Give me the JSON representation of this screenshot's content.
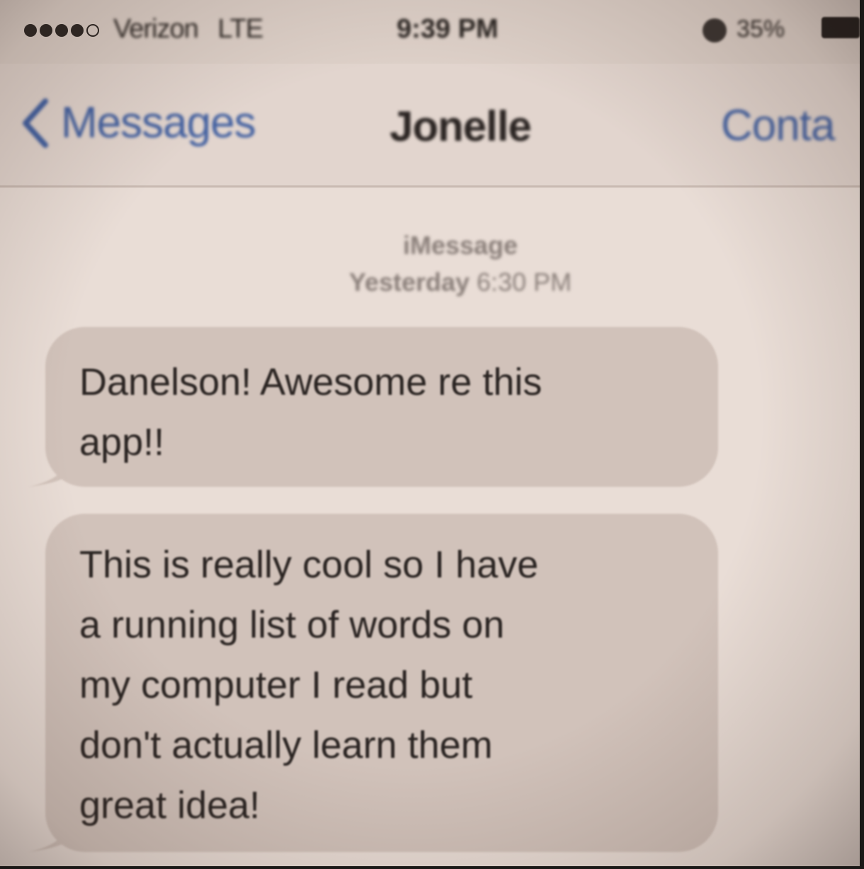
{
  "status_bar": {
    "carrier": "Verizon",
    "network": "LTE",
    "time": "9:39 PM",
    "battery": "35%",
    "signal_bars_filled": 4,
    "signal_bars_total": 5
  },
  "nav": {
    "back_label": "Messages",
    "title": "Jonelle",
    "contact_label": "Conta"
  },
  "conversation": {
    "service": "iMessage",
    "timestamp_day": "Yesterday",
    "timestamp_time": "6:30 PM",
    "messages": [
      {
        "lines": [
          "Danelson! Awesome re this",
          "app!!"
        ]
      },
      {
        "lines": [
          "This is really cool so I have",
          "a running list of words on",
          "my computer I read but",
          "don't actually learn them",
          "great idea!"
        ]
      }
    ]
  },
  "colors": {
    "accent": "#405fa0",
    "bubble": "#d1c2ba",
    "background": "#e9ddd6"
  }
}
